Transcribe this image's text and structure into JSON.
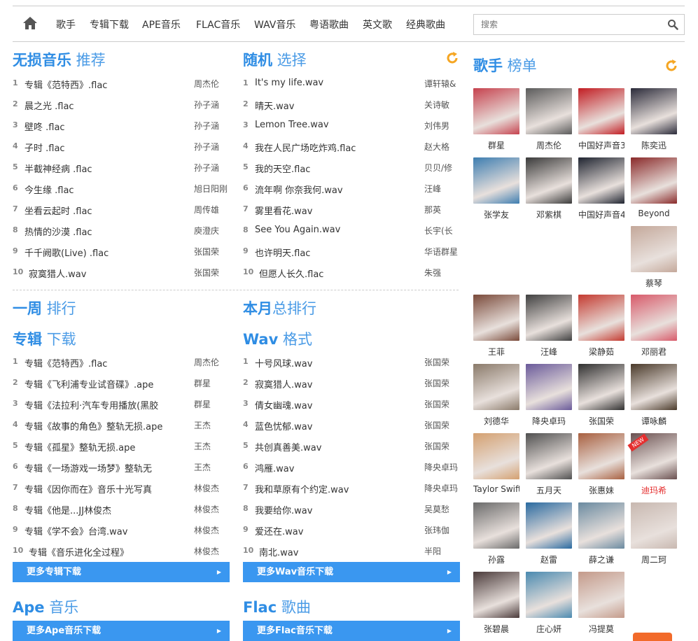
{
  "nav": {
    "items": [
      "歌手",
      "专辑下载",
      "APE音乐",
      "FLAC音乐",
      "WAV音乐",
      "粤语歌曲",
      "英文歌",
      "经典歌曲"
    ],
    "search_placeholder": "搜索"
  },
  "lossless": {
    "title_bold": "无损音乐",
    "title_rest": " 推荐",
    "rows": [
      {
        "n": "1",
        "t": "专辑《范特西》.flac",
        "a": "周杰伦"
      },
      {
        "n": "2",
        "t": "晨之光 .flac",
        "a": "孙子涵"
      },
      {
        "n": "3",
        "t": "壁咚 .flac",
        "a": "孙子涵"
      },
      {
        "n": "4",
        "t": "子时 .flac",
        "a": "孙子涵"
      },
      {
        "n": "5",
        "t": "半截神经病 .flac",
        "a": "孙子涵"
      },
      {
        "n": "6",
        "t": "今生缘 .flac",
        "a": "旭日阳刚"
      },
      {
        "n": "7",
        "t": "坐看云起时 .flac",
        "a": "周传雄"
      },
      {
        "n": "8",
        "t": "热情的沙漠 .flac",
        "a": "庾澄庆"
      },
      {
        "n": "9",
        "t": "千千阙歌(Live) .flac",
        "a": "张国荣"
      },
      {
        "n": "10",
        "t": "寂寞猎人.wav",
        "a": "张国荣"
      }
    ]
  },
  "random": {
    "title_bold": "随机",
    "title_rest": " 选择",
    "rows": [
      {
        "n": "1",
        "t": "It's my life.wav",
        "a": "谭轩辕&"
      },
      {
        "n": "2",
        "t": "晴天.wav",
        "a": "关诗敏"
      },
      {
        "n": "3",
        "t": "Lemon Tree.wav",
        "a": "刘伟男"
      },
      {
        "n": "4",
        "t": "我在人民广场吃炸鸡.flac",
        "a": "赵大格"
      },
      {
        "n": "5",
        "t": "我的天空.flac",
        "a": "贝贝/修"
      },
      {
        "n": "6",
        "t": "流年啊 你奈我何.wav",
        "a": "汪峰"
      },
      {
        "n": "7",
        "t": "雾里看花.wav",
        "a": "那英"
      },
      {
        "n": "8",
        "t": "See You Again.wav",
        "a": "长宇(长"
      },
      {
        "n": "9",
        "t": "也许明天.flac",
        "a": "华语群星"
      },
      {
        "n": "10",
        "t": "但愿人长久.flac",
        "a": "朱强"
      }
    ]
  },
  "weekly": {
    "title_bold": "一周",
    "title_rest": " 排行"
  },
  "monthly": {
    "title_bold": "本月",
    "title_rest": "总排行"
  },
  "album": {
    "title_bold": "专辑",
    "title_rest": " 下载",
    "rows": [
      {
        "n": "1",
        "t": "专辑《范特西》.flac",
        "a": "周杰伦"
      },
      {
        "n": "2",
        "t": "专辑《飞利浦专业试音碟》.ape",
        "a": "群星"
      },
      {
        "n": "3",
        "t": "专辑《法拉利·汽车专用播放(黑胶",
        "a": "群星"
      },
      {
        "n": "4",
        "t": "专辑《故事的角色》整轨无损.ape",
        "a": "王杰"
      },
      {
        "n": "5",
        "t": "专辑《孤星》整轨无损.ape",
        "a": "王杰"
      },
      {
        "n": "6",
        "t": "专辑《一场游戏一场梦》整轨无",
        "a": "王杰"
      },
      {
        "n": "7",
        "t": "专辑《因你而在》音乐十光写真",
        "a": "林俊杰"
      },
      {
        "n": "8",
        "t": "专辑《他是...JJ林俊杰",
        "a": "林俊杰"
      },
      {
        "n": "9",
        "t": "专辑《学不会》台湾.wav",
        "a": "林俊杰"
      },
      {
        "n": "10",
        "t": "专辑《音乐进化全过程》",
        "a": "林俊杰"
      }
    ],
    "more": "更多专辑下载"
  },
  "wav": {
    "title_bold": "Wav",
    "title_rest": " 格式",
    "rows": [
      {
        "n": "1",
        "t": "十号风球.wav",
        "a": "张国荣"
      },
      {
        "n": "2",
        "t": "寂寞猎人.wav",
        "a": "张国荣"
      },
      {
        "n": "3",
        "t": "倩女幽魂.wav",
        "a": "张国荣"
      },
      {
        "n": "4",
        "t": "蓝色忧郁.wav",
        "a": "张国荣"
      },
      {
        "n": "5",
        "t": "共创真善美.wav",
        "a": "张国荣"
      },
      {
        "n": "6",
        "t": "鸿雁.wav",
        "a": "降央卓玛"
      },
      {
        "n": "7",
        "t": "我和草原有个约定.wav",
        "a": "降央卓玛"
      },
      {
        "n": "8",
        "t": "我要给你.wav",
        "a": "吴莫愁"
      },
      {
        "n": "9",
        "t": "爱还在.wav",
        "a": "张玮伽"
      },
      {
        "n": "10",
        "t": "南北.wav",
        "a": "半阳"
      }
    ],
    "more": "更多Wav音乐下载"
  },
  "ape": {
    "title_bold": "Ape",
    "title_rest": " 音乐",
    "more": "更多Ape音乐下载"
  },
  "flac": {
    "title_bold": "Flac",
    "title_rest": " 歌曲",
    "more": "更多Flac音乐下载"
  },
  "singers": {
    "title_bold": "歌手",
    "title_rest": " 榜单",
    "list": [
      {
        "name": "群星",
        "color": "#c6424e"
      },
      {
        "name": "周杰伦",
        "color": "#5b5b5b"
      },
      {
        "name": "中国好声音3",
        "color": "#c21d23"
      },
      {
        "name": "陈奕迅",
        "color": "#2b2b3a"
      },
      {
        "name": "张学友",
        "color": "#3d7db0"
      },
      {
        "name": "邓紫棋",
        "color": "#3a3a3a"
      },
      {
        "name": "中国好声音4",
        "color": "#1f2430"
      },
      {
        "name": "Beyond",
        "color": "#8a2a2a"
      },
      {
        "name": "蔡琴",
        "color": "#c4a89a"
      },
      {
        "name": "王菲",
        "color": "#7a4a3a"
      },
      {
        "name": "汪峰",
        "color": "#404040"
      },
      {
        "name": "梁静茹",
        "color": "#c43a30"
      },
      {
        "name": "邓丽君",
        "color": "#d85a6a"
      },
      {
        "name": "刘德华",
        "color": "#8a7a6a"
      },
      {
        "name": "降央卓玛",
        "color": "#6a5a9a"
      },
      {
        "name": "张国荣",
        "color": "#303030"
      },
      {
        "name": "谭咏麟",
        "color": "#4a3a2a"
      },
      {
        "name": "Taylor Swift",
        "color": "#d4a070"
      },
      {
        "name": "五月天",
        "color": "#505050"
      },
      {
        "name": "张惠妹",
        "color": "#a86040"
      },
      {
        "name": "迪玛希",
        "color": "#6a5050"
      },
      {
        "name": "孙露",
        "color": "#6a6a6a"
      },
      {
        "name": "赵雷",
        "color": "#2a6aa0"
      },
      {
        "name": "薛之谦",
        "color": "#6a8aa0"
      },
      {
        "name": "周二珂",
        "color": "#c8b8b0"
      },
      {
        "name": "张碧晨",
        "color": "#4a3a3a"
      },
      {
        "name": "庄心妍",
        "color": "#4a8ab0"
      },
      {
        "name": "冯提莫",
        "color": "#c49a8a"
      }
    ],
    "new_badge": "NEW"
  },
  "colors": {
    "accent": "#2f8de4",
    "button": "#3a97f0",
    "refresh": "#f5a623",
    "highlight": "#e52f2f"
  }
}
